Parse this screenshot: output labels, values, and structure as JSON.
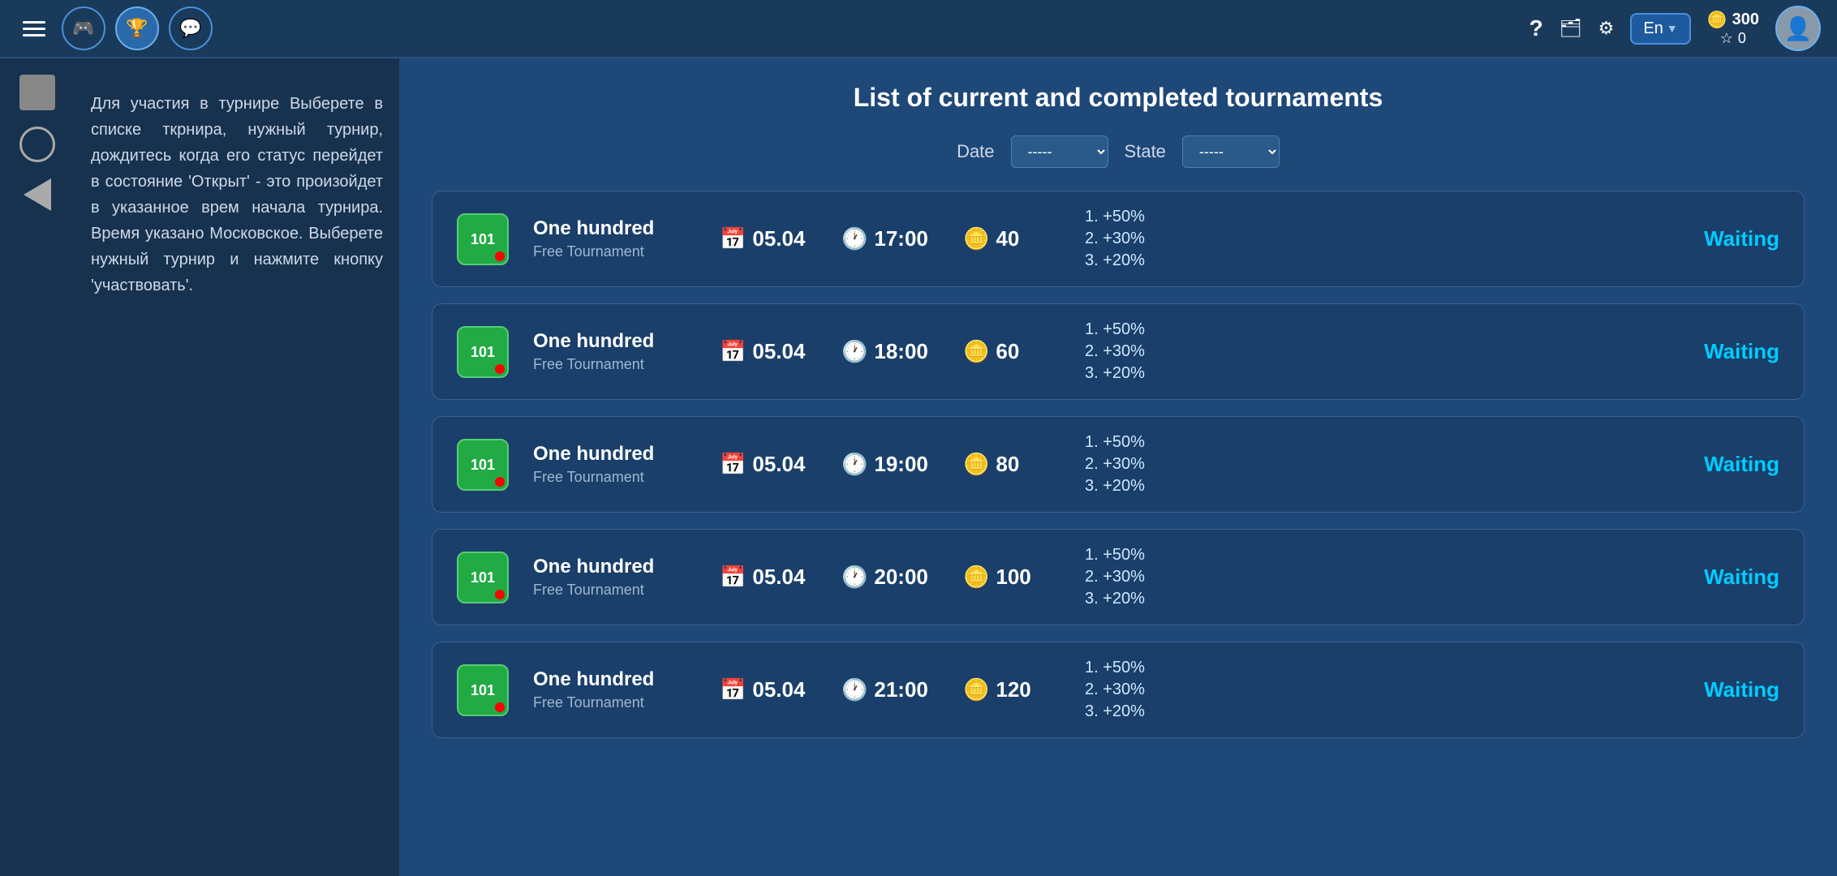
{
  "topbar": {
    "hamburger_label": "menu",
    "nav_buttons": [
      {
        "id": "gamepad",
        "icon": "🎮",
        "active": false
      },
      {
        "id": "trophy",
        "icon": "🏆",
        "active": true
      },
      {
        "id": "chat",
        "icon": "💬",
        "active": false
      }
    ],
    "help_label": "?",
    "wallet_icon": "👛",
    "settings_icon": "⚙",
    "lang": "En",
    "coins": "300",
    "stars": "0"
  },
  "sidebar": {
    "items": [
      {
        "id": "square",
        "type": "square"
      },
      {
        "id": "circle",
        "type": "circle"
      },
      {
        "id": "back",
        "type": "triangle"
      }
    ]
  },
  "instruction": {
    "text": "Для участия в турнире Выберете в списке ткрнира, нужный турнир, дождитесь когда его статус перейдет в состояние 'Открыт' - это произойдет в указанное врем начала турнира. Время указано Московское. Выберете нужный турнир и нажмите кнопку 'участвовать'."
  },
  "tournament_panel": {
    "title": "List of current and completed tournaments",
    "filters": {
      "date_label": "Date",
      "date_value": "-----",
      "state_label": "State",
      "state_value": "-----"
    },
    "tournaments": [
      {
        "id": 1,
        "icon_text": "101",
        "name": "One hundred",
        "subtitle": "Free Tournament",
        "date": "05.04",
        "time": "17:00",
        "coins": "40",
        "prize1": "1. +50%",
        "prize2": "2. +30%",
        "prize3": "3. +20%",
        "status": "Waiting"
      },
      {
        "id": 2,
        "icon_text": "101",
        "name": "One hundred",
        "subtitle": "Free Tournament",
        "date": "05.04",
        "time": "18:00",
        "coins": "60",
        "prize1": "1. +50%",
        "prize2": "2. +30%",
        "prize3": "3. +20%",
        "status": "Waiting"
      },
      {
        "id": 3,
        "icon_text": "101",
        "name": "One hundred",
        "subtitle": "Free Tournament",
        "date": "05.04",
        "time": "19:00",
        "coins": "80",
        "prize1": "1. +50%",
        "prize2": "2. +30%",
        "prize3": "3. +20%",
        "status": "Waiting"
      },
      {
        "id": 4,
        "icon_text": "101",
        "name": "One hundred",
        "subtitle": "Free Tournament",
        "date": "05.04",
        "time": "20:00",
        "coins": "100",
        "prize1": "1. +50%",
        "prize2": "2. +30%",
        "prize3": "3. +20%",
        "status": "Waiting"
      },
      {
        "id": 5,
        "icon_text": "101",
        "name": "One hundred",
        "subtitle": "Free Tournament",
        "date": "05.04",
        "time": "21:00",
        "coins": "120",
        "prize1": "1. +50%",
        "prize2": "2. +30%",
        "prize3": "3. +20%",
        "status": "Waiting"
      }
    ]
  }
}
